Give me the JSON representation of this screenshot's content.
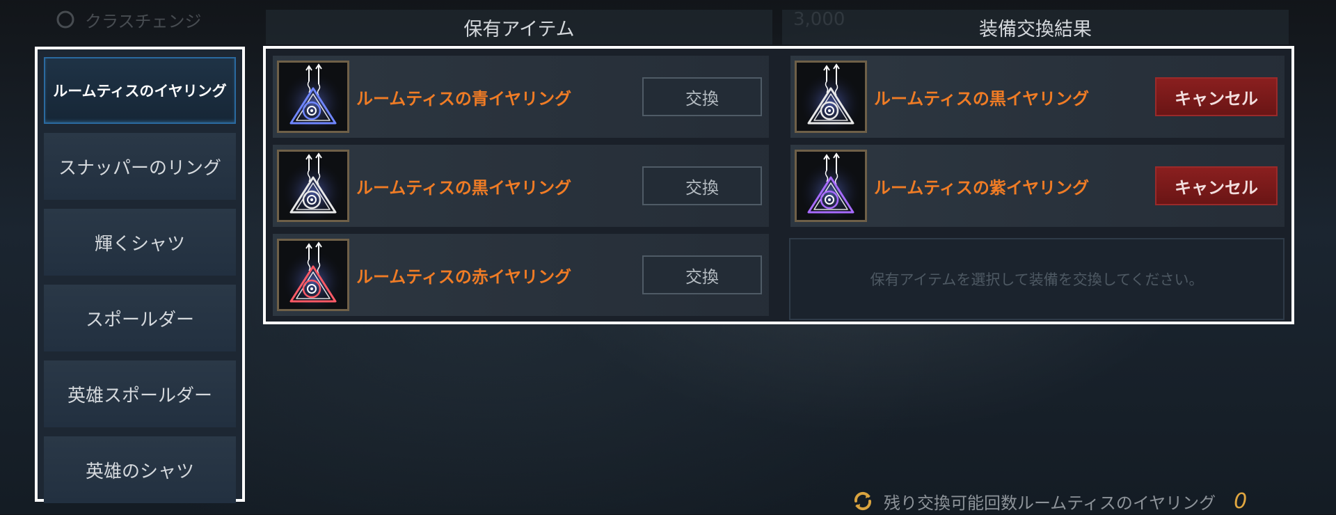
{
  "top": {
    "partial_title": "クラスチェンジ",
    "partial_value": "3,000"
  },
  "sidebar": {
    "items": [
      {
        "label": "ルームティスのイヤリング",
        "active": true
      },
      {
        "label": "スナッパーのリング",
        "active": false
      },
      {
        "label": "輝くシャツ",
        "active": false
      },
      {
        "label": "スポールダー",
        "active": false
      },
      {
        "label": "英雄スポールダー",
        "active": false
      },
      {
        "label": "英雄のシャツ",
        "active": false
      }
    ]
  },
  "owned": {
    "header": "保有アイテム",
    "items": [
      {
        "name": "ルームティスの青イヤリング",
        "color": "#6f86ff",
        "button": "交換"
      },
      {
        "name": "ルームティスの黒イヤリング",
        "color": "#e8e8e8",
        "button": "交換"
      },
      {
        "name": "ルームティスの赤イヤリング",
        "color": "#ff5a66",
        "button": "交換"
      }
    ]
  },
  "result": {
    "header": "装備交換結果",
    "items": [
      {
        "name": "ルームティスの黒イヤリング",
        "color": "#e8e8e8",
        "button": "キャンセル"
      },
      {
        "name": "ルームティスの紫イヤリング",
        "color": "#a86bff",
        "button": "キャンセル"
      }
    ],
    "empty_message": "保有アイテムを選択して装備を交換してください。"
  },
  "footer": {
    "label": "残り交換可能回数ルームティスのイヤリング",
    "count": "0",
    "icon": "refresh-icon"
  },
  "colors": {
    "item_name": "#f07c25",
    "cancel_bg": "#8a1f1f",
    "active_glow": "#2a6aa0",
    "count": "#e0a640"
  }
}
